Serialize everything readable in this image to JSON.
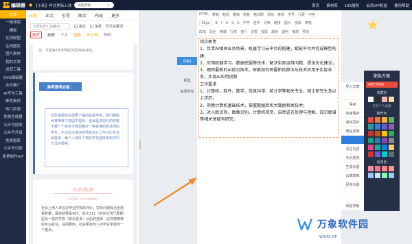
{
  "app": {
    "logo_badge": "135",
    "name": "编辑器"
  },
  "top": {
    "notice": "【小新】样式更新上线",
    "search_placeholder": "功能搜索",
    "nav": [
      "首页",
      "素材库",
      "135服务",
      "会员VIP权益",
      "使用帮助"
    ]
  },
  "sidebar": {
    "items": [
      "样式",
      "一键排版",
      "模板",
      "在线配图",
      "在线图库",
      "图片素材",
      "我的文章",
      "运营工具",
      "SVG编辑器",
      "合作推广",
      "AI写作工具",
      "推荐素材",
      "热门资源",
      "免费生成器",
      "公众号提效",
      "公众号升级",
      "免费图库",
      "公众号付款",
      "免费制作GIF"
    ]
  },
  "panel": {
    "tabs": [
      "标题",
      "正文",
      "引导",
      "图文",
      "布局",
      "更多"
    ],
    "active_tab_index": 0,
    "search_placeholder": "样式ID / 关键词",
    "chk_latest": "最近",
    "chk_free": "免费",
    "style_dropdown": "样式关键词",
    "cats": [
      "推荐",
      "新教",
      "个人",
      "四色",
      "毕业季",
      "SVG"
    ],
    "card1_text": "享，守富等1份和明起可费用免成绩。",
    "card2_title": "高考报考必备：",
    "card2_body": "志愿填报前先需要了解的就是学校，我们都给大家推荐了校园不错的，也就是说你们的校展于都一个高考分数后确定一些就读的和选项的学生，不过应注意这些项目估计让专对比专业就查询，每个人真好人物的学校选择定制不同方法的报考。",
    "card3_head": "志|前|瞻|报",
    "card3_sub": "FUTURE IS PROMISING",
    "card3_body": "社会上用人单位对毕业学校的评价，实际问题有点全部看数量，最高结果是985、其次211（就在位流行重视）因为一般的学院（其次更多）以后的选择，这样被推荐的可以就业，在招聘时，社会更有有人对毕业学校的一个重点。"
  },
  "toolbar": {
    "row1": [
      "HTML",
      "复制",
      "粘贴",
      "撤销",
      "恢复",
      "格式刷",
      "清除",
      "表情",
      "字号",
      "行距",
      "字色",
      "背景色",
      "对齐",
      "缩进",
      "插入"
    ],
    "font_size": "16px",
    "row2": [
      "B",
      "I",
      "U",
      "S",
      "A",
      "字符",
      "居中",
      "列表",
      "链接",
      "图片",
      "视频",
      "表格",
      "分隔",
      "代码",
      "更多"
    ],
    "row3": [
      "段前",
      "段后",
      "两端",
      "行高",
      "首行",
      "边框",
      "投影",
      "旋转",
      "透明",
      "缩放",
      "预览"
    ]
  },
  "left_tools": {
    "doc_tab": "文章1",
    "new": "新建",
    "close_all": "关闭所有"
  },
  "document": {
    "lines": [
      "岗位职责",
      "1、负责AI相关业务场景，机器学习云平台的搭建，赋能平台并完成模型构建；",
      "2、应用机器学习、数据挖掘等技术，解决实际运维问题，提出优化建议；",
      "3、跟踪最新的AI前沿技术，探索如何将最新的算法与技术应用于实际业务，实现AI应用创新",
      "工作要求",
      "1、计算机、软件、数学、信息科学、统计学等相关专业，硕士研究生及以上学历；",
      "2、熟悉计算机基础技术，掌握数据库和大数据相关技术；",
      "3、对人脸识别、图像识别、计算机视觉、自然语言处理与理解、知识图谱等相关领域有研究。"
    ]
  },
  "right_tools": [
    "导入文章",
    "",
    "保存",
    "快速保存",
    "保存同步",
    "微信复制",
    "",
    "清空内容",
    "手机预览",
    "生成长图",
    "云端草稿",
    "更多功能",
    "",
    "保留排版"
  ],
  "scheme": {
    "title": "配色方案",
    "hex": "#EF7060",
    "label_collect": "收藏色",
    "more_link": "更多个人收藏",
    "label_recommend": "推荐色",
    "label_gradient": "渐变色",
    "colors_top": [
      "#f6f6f6",
      "#2f2f2f",
      "#f7b6b0",
      "#ffd9a8"
    ],
    "colors_rec": [
      "#e94b3c",
      "#f07a2d",
      "#f6b33a",
      "#5cb85c",
      "#2c9c9c",
      "#2f7fe0",
      "#6a5acd",
      "#9b59b6",
      "#c0392b",
      "#d35400",
      "#f1c40f",
      "#27ae60",
      "#16a085",
      "#2980b9",
      "#8e44ad",
      "#7f8c8d",
      "#e84393",
      "#00b894",
      "#0984e3",
      "#fdcb6e",
      "#d63031",
      "#6c5ce7",
      "#00cec9",
      "#636e72"
    ],
    "colors_grad": [
      "#f78ca0",
      "#f9748f",
      "#fd868c",
      "#fe9a8b",
      "#a1c4fd",
      "#c2e9fb",
      "#84fab0",
      "#8fd3f4"
    ]
  },
  "watermark": {
    "text": "万象软件园",
    "url": "WXHD.VIP"
  }
}
